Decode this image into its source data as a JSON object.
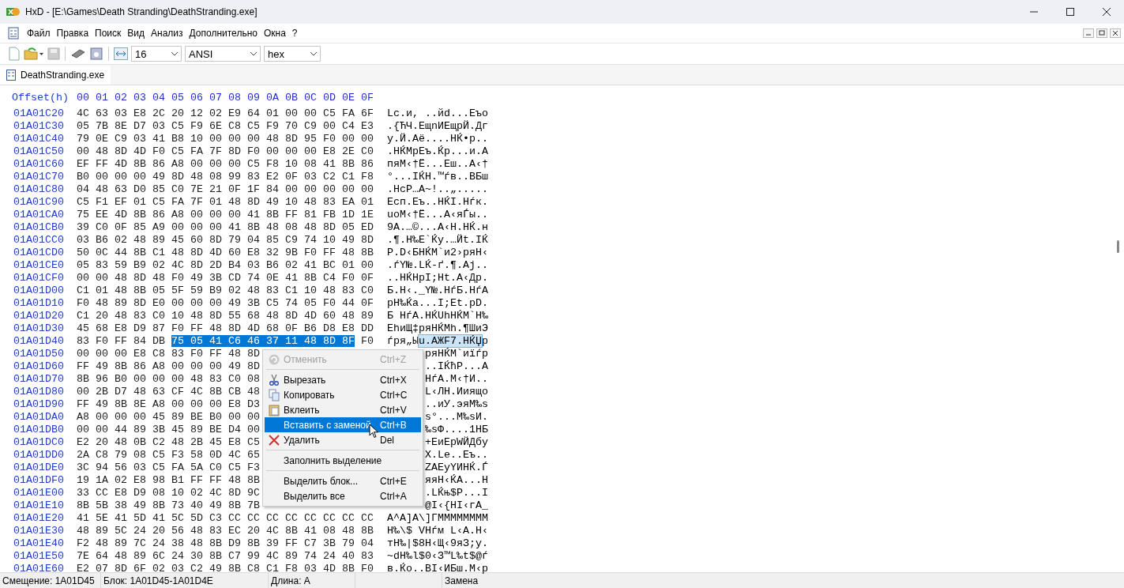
{
  "window": {
    "title": "HxD - [E:\\Games\\Death Stranding\\DeathStranding.exe]"
  },
  "menu_bar": [
    "Файл",
    "Правка",
    "Поиск",
    "Вид",
    "Анализ",
    "Дополнительно",
    "Окна",
    "?"
  ],
  "toolbar": {
    "bytes_per_row": "16",
    "charset": "ANSI",
    "offset_base": "hex"
  },
  "tabs": [
    {
      "label": "DeathStranding.exe",
      "selected": true
    }
  ],
  "hex_view": {
    "header": {
      "label": "Offset(h)",
      "columns": [
        "00",
        "01",
        "02",
        "03",
        "04",
        "05",
        "06",
        "07",
        "08",
        "09",
        "0A",
        "0B",
        "0C",
        "0D",
        "0E",
        "0F"
      ]
    },
    "rows": [
      {
        "offset": "01A01C20",
        "hex": [
          {
            "bytes": "4C 63 03 E8 2C 20 12 02 E9 64 01 00 00 C5 FA 6F",
            "selected": false
          }
        ],
        "text": [
          {
            "chars": "Lc.и, ..йd...Еъo",
            "selected": false
          }
        ]
      },
      {
        "offset": "01A01C30",
        "hex": [
          {
            "bytes": "05 7B 8E D7 03 C5 F9 6E C8 C5 F9 70 C9 00 C4 E3",
            "selected": false
          }
        ],
        "text": [
          {
            "chars": ".{ЋЧ.ЕщnИЕщpЙ.Дг",
            "selected": false
          }
        ]
      },
      {
        "offset": "01A01C40",
        "hex": [
          {
            "bytes": "79 0E C9 03 41 B8 10 00 00 00 48 8D 95 F0 00 00",
            "selected": false
          }
        ],
        "text": [
          {
            "chars": "y.Й.Aё....HЌ•р..",
            "selected": false
          }
        ]
      },
      {
        "offset": "01A01C50",
        "hex": [
          {
            "bytes": "00 48 8D 4D F0 C5 FA 7F 8D F0 00 00 00 E8 2E C0",
            "selected": false
          }
        ],
        "text": [
          {
            "chars": ".HЌMрЕъ.Ќр...и.А",
            "selected": false
          }
        ]
      },
      {
        "offset": "01A01C60",
        "hex": [
          {
            "bytes": "EF FF 4D 8B 86 A8 00 00 00 C5 F8 10 08 41 8B 86",
            "selected": false
          }
        ],
        "text": [
          {
            "chars": "пяM‹†Ё...Еш..A‹†",
            "selected": false
          }
        ]
      },
      {
        "offset": "01A01C70",
        "hex": [
          {
            "bytes": "B0 00 00 00 49 8D 48 08 99 83 E2 0F 03 C2 C1 F8",
            "selected": false
          }
        ],
        "text": [
          {
            "chars": "°...IЌH.™ѓв..ВБш",
            "selected": false
          }
        ]
      },
      {
        "offset": "01A01C80",
        "hex": [
          {
            "bytes": "04 48 63 D0 85 C0 7E 21 0F 1F 84 00 00 00 00 00",
            "selected": false
          }
        ],
        "text": [
          {
            "chars": ".HcР…А~!..„.....",
            "selected": false
          }
        ]
      },
      {
        "offset": "01A01C90",
        "hex": [
          {
            "bytes": "C5 F1 EF 01 C5 FA 7F 01 48 8D 49 10 48 83 EA 01",
            "selected": false
          }
        ],
        "text": [
          {
            "chars": "Есп.Еъ..HЌI.Hѓк.",
            "selected": false
          }
        ]
      },
      {
        "offset": "01A01CA0",
        "hex": [
          {
            "bytes": "75 EE 4D 8B 86 A8 00 00 00 41 8B FF 81 FB 1D 1E",
            "selected": false
          }
        ],
        "text": [
          {
            "chars": "uоM‹†Ё...A‹яЃы..",
            "selected": false
          }
        ]
      },
      {
        "offset": "01A01CB0",
        "hex": [
          {
            "bytes": "39 C0 0F 85 A9 00 00 00 41 8B 48 08 48 8D 05 ED",
            "selected": false
          }
        ],
        "text": [
          {
            "chars": "9А.…©...A‹H.HЌ.н",
            "selected": false
          }
        ]
      },
      {
        "offset": "01A01CC0",
        "hex": [
          {
            "bytes": "03 B6 02 48 89 45 60 8D 79 04 85 C9 74 10 49 8D",
            "selected": false
          }
        ],
        "text": [
          {
            "chars": ".¶.H‰E`Ќy.…Йt.IЌ",
            "selected": false
          }
        ]
      },
      {
        "offset": "01A01CD0",
        "hex": [
          {
            "bytes": "50 0C 44 8B C1 48 8D 4D 60 E8 32 9B F0 FF 48 8B",
            "selected": false
          }
        ],
        "text": [
          {
            "chars": "P.D‹БHЌM`и2›ряH‹",
            "selected": false
          }
        ]
      },
      {
        "offset": "01A01CE0",
        "hex": [
          {
            "bytes": "05 83 59 B9 02 4C 8D 2D B4 03 B6 02 41 BC 01 00",
            "selected": false
          }
        ],
        "text": [
          {
            "chars": ".ѓY№.LЌ-ґ.¶.Aј..",
            "selected": false
          }
        ]
      },
      {
        "offset": "01A01CF0",
        "hex": [
          {
            "bytes": "00 00 48 8D 48 F0 49 3B CD 74 0E 41 8B C4 F0 0F",
            "selected": false
          }
        ],
        "text": [
          {
            "chars": "..HЌHрI;Нt.A‹Др.",
            "selected": false
          }
        ]
      },
      {
        "offset": "01A01D00",
        "hex": [
          {
            "bytes": "C1 01 48 8B 05 5F 59 B9 02 48 83 C1 10 48 83 C0",
            "selected": false
          }
        ],
        "text": [
          {
            "chars": "Б.H‹._Y№.HѓБ.HѓА",
            "selected": false
          }
        ]
      },
      {
        "offset": "01A01D10",
        "hex": [
          {
            "bytes": "F0 48 89 8D E0 00 00 00 49 3B C5 74 05 F0 44 0F",
            "selected": false
          }
        ],
        "text": [
          {
            "chars": "рH‰Ќа...I;Еt.рD.",
            "selected": false
          }
        ]
      },
      {
        "offset": "01A01D20",
        "hex": [
          {
            "bytes": "C1 20 48 83 C0 10 48 8D 55 68 48 8D 4D 60 48 89",
            "selected": false
          }
        ],
        "text": [
          {
            "chars": "Б HѓА.HЌUhHЌM`H‰",
            "selected": false
          }
        ]
      },
      {
        "offset": "01A01D30",
        "hex": [
          {
            "bytes": "45 68 E8 D9 87 F0 FF 48 8D 4D 68 0F B6 D8 E8 DD",
            "selected": false
          }
        ],
        "text": [
          {
            "chars": "EhиЩ‡ряHЌMh.¶ШиЭ",
            "selected": false
          }
        ]
      },
      {
        "offset": "01A01D40",
        "hex": [
          {
            "bytes": "83 F0 FF 84 DB",
            "selected": false
          },
          {
            "bytes": "75 05 41 C6 46 37 11 48 8D 8F",
            "selected": true
          },
          {
            "bytes": "F0",
            "selected": false
          }
        ],
        "text": [
          {
            "chars": "ѓря„Ы",
            "selected": false
          },
          {
            "chars": "u.AЖF7.HЌЏ",
            "selected": true
          },
          {
            "chars": "р",
            "selected": false
          }
        ]
      },
      {
        "offset": "01A01D50",
        "hex": [
          {
            "bytes": "00 00 00 E8 C8 83 F0 FF 48 8D",
            "selected": false
          }
        ],
        "text": [
          {
            "chars": "ряHЌM`иїѓр",
            "selected": false
          }
        ]
      },
      {
        "offset": "01A01D60",
        "hex": [
          {
            "bytes": "FF 49 8B 86 A8 00 00 00 49 8D",
            "selected": false
          }
        ],
        "text": [
          {
            "chars": "..IЌћP...A",
            "selected": false
          }
        ]
      },
      {
        "offset": "01A01D70",
        "hex": [
          {
            "bytes": "8B 96 B0 00 00 00 48 83 C0 08",
            "selected": false
          }
        ],
        "text": [
          {
            "chars": "HѓА.M‹†И..",
            "selected": false
          }
        ]
      },
      {
        "offset": "01A01D80",
        "hex": [
          {
            "bytes": "00 2B D7 48 63 CF 4C 8B CB 48",
            "selected": false
          }
        ],
        "text": [
          {
            "chars": "L‹ЛH.Ииящо",
            "selected": false
          }
        ]
      },
      {
        "offset": "01A01D90",
        "hex": [
          {
            "bytes": "FF 49 8B 8E A8 00 00 00 E8 D3",
            "selected": false
          }
        ],
        "text": [
          {
            "chars": "..иУ.эяM‰s",
            "selected": false
          }
        ]
      },
      {
        "offset": "01A01DA0",
        "hex": [
          {
            "bytes": "A8 00 00 00 45 89 BE B0 00 00",
            "selected": false
          }
        ],
        "text": [
          {
            "chars": "ѕ°...M‰ѕИ.",
            "selected": false
          }
        ]
      },
      {
        "offset": "01A01DB0",
        "hex": [
          {
            "bytes": "00 00 44 89 3B 45 89 BE D4 00",
            "selected": false
          }
        ],
        "text": [
          {
            "chars": "‰ѕФ....1HБ",
            "selected": false
          }
        ]
      },
      {
        "offset": "01A01DC0",
        "hex": [
          {
            "bytes": "E2 20 48 0B C2 48 2B 45 E8 C5",
            "selected": false
          }
        ],
        "text": [
          {
            "chars": "+EиЕрWЙДбу",
            "selected": false
          }
        ]
      },
      {
        "offset": "01A01DD0",
        "hex": [
          {
            "bytes": "2A C8 79 08 C5 F3 58 0D 4C 65",
            "selected": false
          }
        ],
        "text": [
          {
            "chars": "X.Le..Еъ..",
            "selected": false
          }
        ]
      },
      {
        "offset": "01A01DE0",
        "hex": [
          {
            "bytes": "3C 94 56 03 C5 FA 5A C0 C5 F3",
            "selected": false
          }
        ],
        "text": [
          {
            "chars": "ZАЕуYИHЌ.Ѓ",
            "selected": false
          }
        ]
      },
      {
        "offset": "01A01DF0",
        "hex": [
          {
            "bytes": "19 1A 02 E8 98 B1 FF FF 48 8B",
            "selected": false
          }
        ],
        "text": [
          {
            "chars": "яяH‹ЌА...H",
            "selected": false
          }
        ]
      },
      {
        "offset": "01A01E00",
        "hex": [
          {
            "bytes": "33 CC E8 D9 08 10 02 4C 8D 9C",
            "selected": false
          }
        ],
        "text": [
          {
            "chars": ".LЌњ$P...I",
            "selected": false
          }
        ]
      },
      {
        "offset": "01A01E10",
        "hex": [
          {
            "bytes": "8B 5B 38 49 8B 73 40 49 8B 7B",
            "selected": false
          }
        ],
        "text": [
          {
            "chars": "@I‹{HI‹гA_",
            "selected": false
          }
        ]
      },
      {
        "offset": "01A01E20",
        "hex": [
          {
            "bytes": "41 5E 41 5D 41 5C 5D C3 CC CC CC CC CC CC CC CC",
            "selected": false
          }
        ],
        "text": [
          {
            "chars": "A^A]A\\]ГММММММММ",
            "selected": false
          }
        ]
      },
      {
        "offset": "01A01E30",
        "hex": [
          {
            "bytes": "48 89 5C 24 20 56 48 83 EC 20 4C 8B 41 08 48 8B",
            "selected": false
          }
        ],
        "text": [
          {
            "chars": "H‰\\$ VHѓм L‹A.H‹",
            "selected": false
          }
        ]
      },
      {
        "offset": "01A01E40",
        "hex": [
          {
            "bytes": "F2 48 89 7C 24 38 48 8B D9 8B 39 FF C7 3B 79 04",
            "selected": false
          }
        ],
        "text": [
          {
            "chars": "тH‰|$8H‹Щ‹9яЗ;y.",
            "selected": false
          }
        ]
      },
      {
        "offset": "01A01E50",
        "hex": [
          {
            "bytes": "7E 64 48 89 6C 24 30 8B C7 99 4C 89 74 24 40 83",
            "selected": false
          }
        ],
        "text": [
          {
            "chars": "~dH‰l$0‹З™L‰t$@ѓ",
            "selected": false
          }
        ]
      },
      {
        "offset": "01A01E60",
        "hex": [
          {
            "bytes": "E2 07 8D 6F 02 03 C2 49 8B C8 C1 F8 03 4D 8B F0",
            "selected": false
          }
        ],
        "text": [
          {
            "chars": "в.Ќo..ВI‹ИБш.M‹р",
            "selected": false
          }
        ]
      }
    ]
  },
  "context_menu": [
    {
      "kind": "item",
      "label": "Отменить",
      "shortcut": "Ctrl+Z",
      "disabled": true,
      "selected": false
    },
    {
      "kind": "separator"
    },
    {
      "kind": "item",
      "label": "Вырезать",
      "shortcut": "Ctrl+X",
      "disabled": false,
      "selected": false
    },
    {
      "kind": "item",
      "label": "Копировать",
      "shortcut": "Ctrl+C",
      "disabled": false,
      "selected": false
    },
    {
      "kind": "item",
      "label": "Вклеить",
      "shortcut": "Ctrl+V",
      "disabled": false,
      "selected": false
    },
    {
      "kind": "item",
      "label": "Вставить с заменой",
      "shortcut": "Ctrl+B",
      "disabled": false,
      "selected": true
    },
    {
      "kind": "item",
      "label": "Удалить",
      "shortcut": "Del",
      "disabled": false,
      "selected": false
    },
    {
      "kind": "separator"
    },
    {
      "kind": "item",
      "label": "Заполнить выделение",
      "disabled": false,
      "selected": false
    },
    {
      "kind": "separator"
    },
    {
      "kind": "item",
      "label": "Выделить блок...",
      "shortcut": "Ctrl+E",
      "disabled": false,
      "selected": false
    },
    {
      "kind": "item",
      "label": "Выделить все",
      "shortcut": "Ctrl+A",
      "disabled": false,
      "selected": false
    }
  ],
  "status_bar": [
    "Смещение: 1A01D45",
    "Блок: 1A01D45-1A01D4E",
    "Длина: A",
    "Замена"
  ]
}
